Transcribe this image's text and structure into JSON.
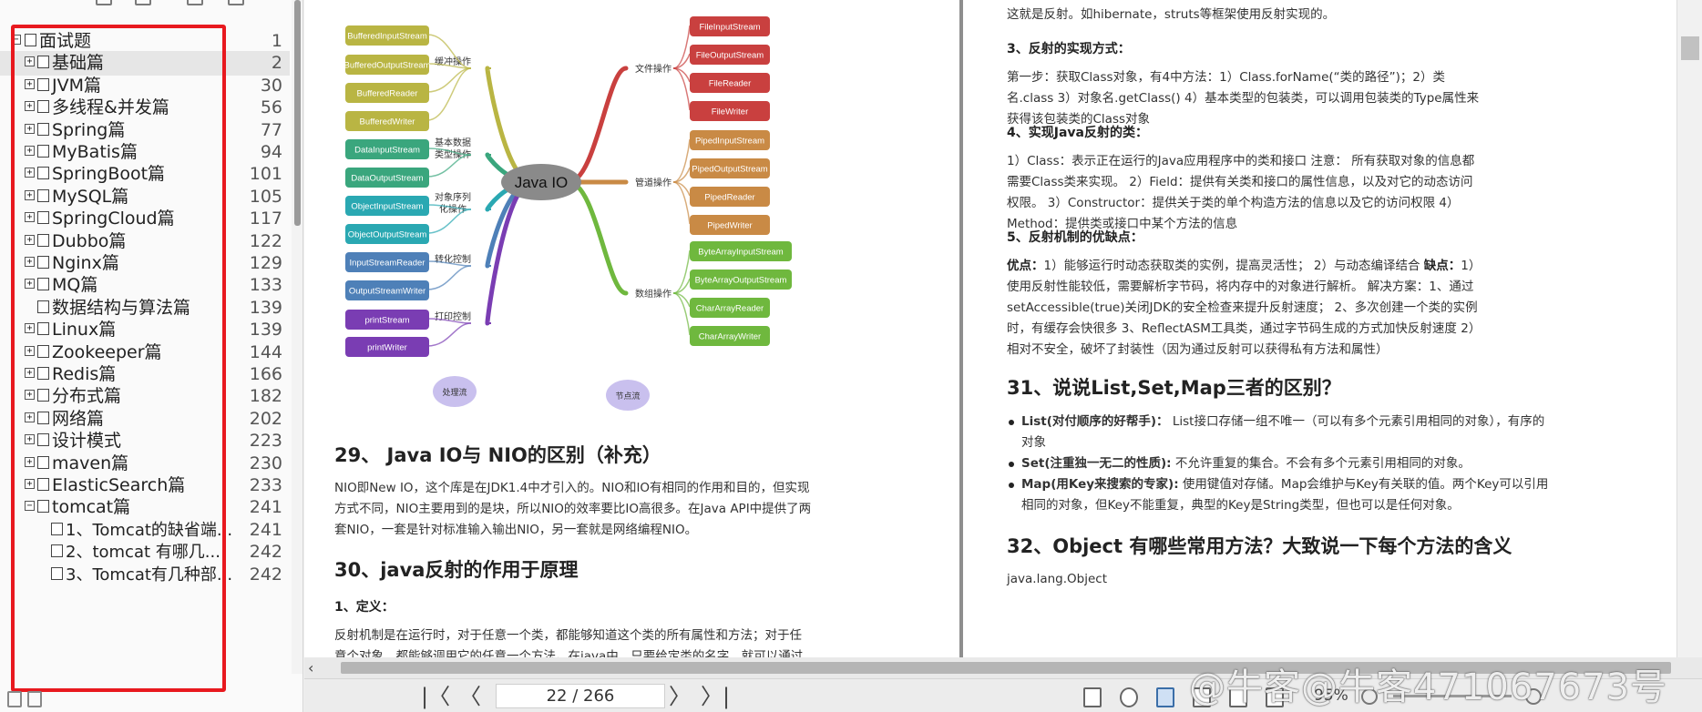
{
  "outline": {
    "items": [
      {
        "label": "面试题",
        "page": "1",
        "expand": "−"
      },
      {
        "label": "基础篇",
        "page": "2",
        "expand": "+"
      },
      {
        "label": "JVM篇",
        "page": "30",
        "expand": "+"
      },
      {
        "label": "多线程&并发篇",
        "page": "56",
        "expand": "+"
      },
      {
        "label": "Spring篇",
        "page": "77",
        "expand": "+"
      },
      {
        "label": "MyBatis篇",
        "page": "94",
        "expand": "+"
      },
      {
        "label": "SpringBoot篇",
        "page": "101",
        "expand": "+"
      },
      {
        "label": "MySQL篇",
        "page": "105",
        "expand": "+"
      },
      {
        "label": "SpringCloud篇",
        "page": "117",
        "expand": "+"
      },
      {
        "label": "Dubbo篇",
        "page": "122",
        "expand": "+"
      },
      {
        "label": "Nginx篇",
        "page": "129",
        "expand": "+"
      },
      {
        "label": "MQ篇",
        "page": "133",
        "expand": "+"
      },
      {
        "label": "数据结构与算法篇",
        "page": "139",
        "expand": ""
      },
      {
        "label": "Linux篇",
        "page": "139",
        "expand": "+"
      },
      {
        "label": "Zookeeper篇",
        "page": "144",
        "expand": "+"
      },
      {
        "label": "Redis篇",
        "page": "166",
        "expand": "+"
      },
      {
        "label": "分布式篇",
        "page": "182",
        "expand": "+"
      },
      {
        "label": "网络篇",
        "page": "202",
        "expand": "+"
      },
      {
        "label": "设计模式",
        "page": "223",
        "expand": "+"
      },
      {
        "label": "maven篇",
        "page": "230",
        "expand": "+"
      },
      {
        "label": "ElasticSearch篇",
        "page": "233",
        "expand": "+"
      },
      {
        "label": "tomcat篇",
        "page": "241",
        "expand": "−"
      },
      {
        "label": "1、Tomcat的缺省端...",
        "page": "241",
        "expand": ""
      },
      {
        "label": "2、tomcat 有哪几...",
        "page": "242",
        "expand": ""
      },
      {
        "label": "3、Tomcat有几种部...",
        "page": "242",
        "expand": ""
      }
    ]
  },
  "mindmap": {
    "center": "Java IO",
    "left_groups": [
      {
        "category": "缓冲操作",
        "nodes": [
          "BufferedInputStream",
          "BufferedOutputStream",
          "BufferedReader",
          "BufferedWriter"
        ],
        "color": "#b9b543"
      },
      {
        "category": "基本数据\n类型操作",
        "nodes": [
          "DataInputStream",
          "DataOutputStream"
        ],
        "color": "#3aa67d"
      },
      {
        "category": "对象序列\n化操作",
        "nodes": [
          "ObjectInputStream",
          "ObjectOutputStream"
        ],
        "color": "#2aa8b2"
      },
      {
        "category": "转化控制",
        "nodes": [
          "InputStreamReader",
          "OutputStreamWriter"
        ],
        "color": "#4e80b8"
      },
      {
        "category": "打印控制",
        "nodes": [
          "printStream",
          "printWriter"
        ],
        "color": "#7a3db3"
      }
    ],
    "right_groups": [
      {
        "category": "文件操作",
        "nodes": [
          "FileInputStream",
          "FileOutputStream",
          "FileReader",
          "FileWriter"
        ],
        "color": "#c9403f"
      },
      {
        "category": "管道操作",
        "nodes": [
          "PipedInputStream",
          "PipedOutputStream",
          "PipedReader",
          "PipedWriter"
        ],
        "color": "#c98a45"
      },
      {
        "category": "数组操作",
        "nodes": [
          "ByteArrayInputStream",
          "ByteArrayOutputStream",
          "CharArrayReader",
          "CharArrayWriter"
        ],
        "color": "#6fb83e"
      }
    ],
    "legend": [
      "处理流",
      "节点流"
    ]
  },
  "left_page": {
    "h29": "29、 Java IO与 NIO的区别（补充）",
    "p29": "NIO即New IO，这个库是在JDK1.4中才引入的。NIO和IO有相同的作用和目的，但实现方式不同，NIO主要用到的是块，所以NIO的效率要比IO高很多。在Java API中提供了两套NIO，一套是针对标准输入输出NIO，另一套就是网络编程NIO。",
    "h30": "30、java反射的作用于原理",
    "h30_1": "1、定义：",
    "p30_1": "反射机制是在运行时，对于任意一个类，都能够知道这个类的所有属性和方法；对于任意个对象，都能够调用它的任意一个方法。在java中，只要给定类的名字，就可以通过反射机制来获得类的所有信息。"
  },
  "right_page": {
    "p_top": "这就是反射。如hibernate，struts等框架使用反射实现的。",
    "h3": "3、反射的实现方式：",
    "p3": "第一步：获取Class对象，有4中方法：1）Class.forName(“类的路径”)；2）类名.class 3）对象名.getClass() 4）基本类型的包装类，可以调用包装类的Type属性来获得该包装类的Class对象",
    "h4": "4、实现Java反射的类：",
    "p4": "1）Class：表示正在运行的Java应用程序中的类和接口 注意： 所有获取对象的信息都需要Class类来实现。 2）Field：提供有关类和接口的属性信息，以及对它的动态访问权限。 3）Constructor：提供关于类的单个构造方法的信息以及它的访问权限 4）Method：提供类或接口中某个方法的信息",
    "h5": "5、反射机制的优缺点：",
    "p5_pre": "优点：",
    "p5_a": "1）能够运行时动态获取类的实例，提高灵活性； 2）与动态编译结合 ",
    "p5_mid": "缺点：",
    "p5_b": "1）使用反射性能较低，需要解析字节码，将内存中的对象进行解析。 解决方案：1、通过setAccessible(true)关闭JDK的安全检查来提升反射速度； 2、多次创建一个类的实例时，有缓存会快很多 3、ReflectASM工具类，通过字节码生成的方式加快反射速度 2）相对不安全，破坏了封装性（因为通过反射可以获得私有方法和属性）",
    "h31": "31、说说List,Set,Map三者的区别？",
    "li1_b": "List(对付顺序的好帮手)：",
    "li1": " List接口存储一组不唯一（可以有多个元素引用相同的对象），有序的对象",
    "li2_b": "Set(注重独一无二的性质):",
    "li2": " 不允许重复的集合。不会有多个元素引用相同的对象。",
    "li3_b": "Map(用Key来搜索的专家):",
    "li3": " 使用键值对存储。Map会维护与Key有关联的值。两个Key可以引用相同的对象，但Key不能重复，典型的Key是String类型，但也可以是任何对象。",
    "h32": "32、Object 有哪些常用方法？大致说一下每个方法的含义",
    "p32": "java.lang.Object"
  },
  "status": {
    "page_indicator": "22 / 266",
    "zoom": "95%",
    "first": "|〈",
    "prev": "〈",
    "next": "〉",
    "last": "〉|"
  },
  "watermark": "@牛客@牛客471067673号"
}
